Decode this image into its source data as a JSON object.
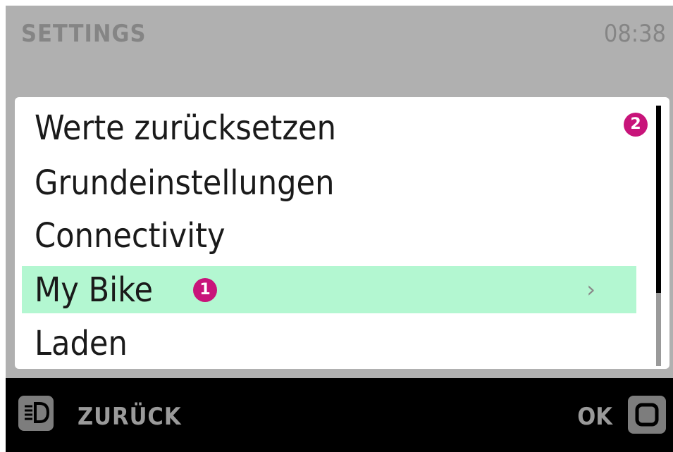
{
  "header": {
    "title": "SETTINGS",
    "time": "08:38"
  },
  "menu": {
    "items": [
      {
        "label": "Werte zurücksetzen",
        "selected": false
      },
      {
        "label": "Grundeinstellungen",
        "selected": false
      },
      {
        "label": "Connectivity",
        "selected": false
      },
      {
        "label": "My Bike",
        "selected": true
      },
      {
        "label": "Laden",
        "selected": false
      }
    ],
    "chevron": "›",
    "scroll_position": 0.72
  },
  "callouts": {
    "item_marker": "1",
    "scrollbar_marker": "2",
    "color": "#c8147a"
  },
  "footer": {
    "back_label": "ZURÜCK",
    "back_icon": "light-button-icon",
    "ok_label": "OK",
    "ok_icon": "square-button-icon"
  },
  "colors": {
    "selected_highlight": "#b3f7d1",
    "header_background": "#b0b0b0",
    "footer_background": "#000000"
  }
}
